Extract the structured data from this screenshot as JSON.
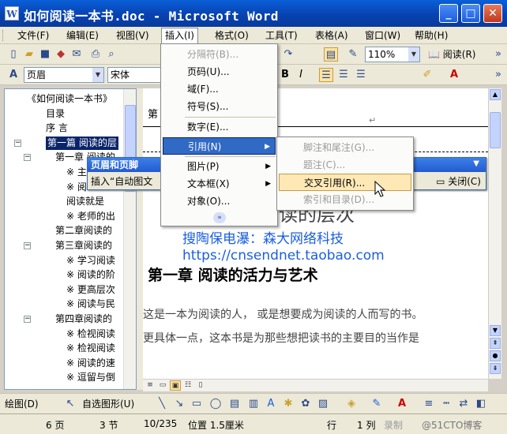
{
  "window": {
    "title": "如何阅读一本书.doc - Microsoft Word",
    "app_icon": "W"
  },
  "menubar": {
    "items": [
      "文件(F)",
      "编辑(E)",
      "视图(V)",
      "插入(I)",
      "格式(O)",
      "工具(T)",
      "表格(A)",
      "窗口(W)",
      "帮助(H)"
    ],
    "active": "插入(I)"
  },
  "toolbar_standard": {
    "zoom": "110%",
    "read_button": "阅读(R)"
  },
  "toolbar_format": {
    "style": "页眉",
    "font": "宋体",
    "bold": "B",
    "italic": "I"
  },
  "insert_menu": {
    "items": [
      {
        "label": "分隔符(B)...",
        "disabled": true
      },
      {
        "label": "页码(U)...",
        "disabled": false
      },
      {
        "label": "域(F)...",
        "disabled": false
      },
      {
        "label": "符号(S)...",
        "disabled": false
      },
      {
        "label": "数字(E)...",
        "disabled": false
      },
      {
        "label": "引用(N)",
        "disabled": false,
        "submenu": true
      },
      {
        "label": "图片(P)",
        "disabled": false,
        "submenu": true
      },
      {
        "label": "文本框(X)",
        "disabled": false,
        "submenu": true
      },
      {
        "label": "对象(O)...",
        "disabled": false
      }
    ],
    "highlighted": "引用(N)"
  },
  "reference_submenu": {
    "items": [
      {
        "label": "脚注和尾注(G)...",
        "disabled": true
      },
      {
        "label": "题注(C)...",
        "disabled": true
      },
      {
        "label": "交叉引用(R)...",
        "disabled": false
      },
      {
        "label": "索引和目录(D)...",
        "disabled": true
      }
    ],
    "highlighted": "交叉引用(R)..."
  },
  "header_footer_toolbar": {
    "title": "页眉和页脚",
    "insert_autotext": "插入“自动图文",
    "close": "关闭(C)"
  },
  "document_map": {
    "items": [
      {
        "label": "《如何阅读一本书》",
        "level": 0
      },
      {
        "label": "目录",
        "level": 1
      },
      {
        "label": "序 言",
        "level": 1
      },
      {
        "label": "第一篇 阅读的层",
        "level": 1,
        "toggle": "-",
        "selected": true
      },
      {
        "label": "第一章 阅读的",
        "level": 2,
        "toggle": "-"
      },
      {
        "label": "※ 主",
        "level": 3
      },
      {
        "label": "※ 阅",
        "level": 3
      },
      {
        "label": "阅读就是",
        "level": 3
      },
      {
        "label": "※ 老师的出",
        "level": 3
      },
      {
        "label": "第二章阅读的",
        "level": 2
      },
      {
        "label": "第三章阅读的",
        "level": 2,
        "toggle": "-"
      },
      {
        "label": "※ 学习阅读",
        "level": 3
      },
      {
        "label": "※ 阅读的阶",
        "level": 3
      },
      {
        "label": "※ 更高层次",
        "level": 3
      },
      {
        "label": "※ 阅读与民",
        "level": 3
      },
      {
        "label": "第四章阅读的",
        "level": 2,
        "toggle": "-"
      },
      {
        "label": "※ 检视阅读",
        "level": 3
      },
      {
        "label": "※ 检视阅读",
        "level": 3
      },
      {
        "label": "※ 阅读的速",
        "level": 3
      },
      {
        "label": "※ 逗留与倒",
        "level": 3
      }
    ]
  },
  "document": {
    "header_fragment": "第",
    "heading_fragment": "读的层次",
    "watermark_line1": "搜陶保电瀑：森大网络科技",
    "watermark_line2": "https://cnsendnet.taobao.com",
    "chapter_title": "第一章  阅读的活力与艺术",
    "para1": "这是一本为阅读的人， 或是想要成为阅读的人而写的书。",
    "para2": "更具体一点，这本书是为那些想把读书的主要目的当作是"
  },
  "drawing_toolbar": {
    "draw": "绘图(D)",
    "autoshapes": "自选图形(U)"
  },
  "statusbar": {
    "page": "6 页",
    "section": "3 节",
    "page_of": "10/235",
    "position": "位置 1.5厘米",
    "line": "行",
    "column": "1 列",
    "rec": "录制",
    "watermark": "@51CTO博客"
  },
  "colors": {
    "title_bar": "#0842b0",
    "menu_highlight": "#316ac5",
    "watermark_text": "#1a5ee0"
  }
}
